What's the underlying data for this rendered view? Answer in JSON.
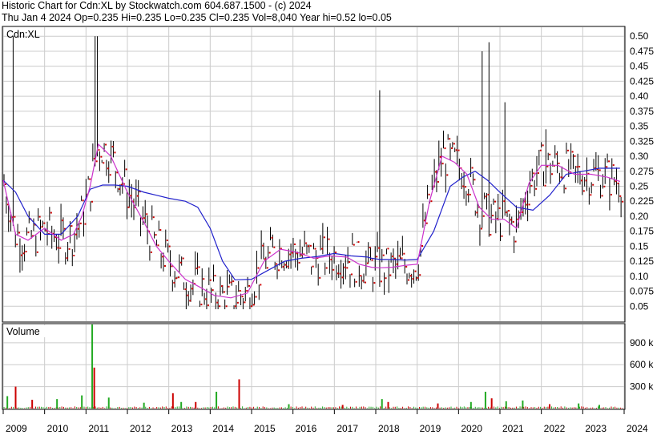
{
  "header": {
    "line1": "Historic Chart for Cdn:XL by Stockwatch.com 604.687.1500 - (c) 2024",
    "line2": "Thu Jan  4 2024  Op=0.235  Hi=0.235  Lo=0.235  Cl=0.235  Vol=8,040  Year hi=0.52  lo=0.05"
  },
  "price_panel": {
    "label": "Cdn:XL"
  },
  "volume_panel": {
    "label": "Volume"
  },
  "colors": {
    "ma_short": "#cc33cc",
    "ma_long": "#2222cc",
    "bar": "#000000",
    "close_dot": "#cc0000",
    "volume_up": "#22aa22",
    "volume_down": "#cc0000",
    "grid": "#cccccc"
  },
  "chart_data": [
    {
      "type": "line",
      "title": "Cdn:XL",
      "x_labels": [
        "2009",
        "2010",
        "2011",
        "2012",
        "2013",
        "2014",
        "2015",
        "2016",
        "2017",
        "2018",
        "2019",
        "2020",
        "2021",
        "2022",
        "2023",
        "2024"
      ],
      "y_ticks": [
        0.05,
        0.075,
        0.1,
        0.125,
        0.15,
        0.175,
        0.2,
        0.225,
        0.25,
        0.275,
        0.3,
        0.325,
        0.35,
        0.375,
        0.4,
        0.425,
        0.45,
        0.475,
        0.5
      ],
      "y_tick_labels": [
        "0.05",
        "0.075",
        "0.10",
        "0.125",
        "0.15",
        "0.175",
        "0.20",
        "0.225",
        "0.25",
        "0.275",
        "0.30",
        "0.325",
        "0.35",
        "0.375",
        "0.40",
        "0.425",
        "0.45",
        "0.475",
        "0.50"
      ],
      "ylim": [
        0.025,
        0.515
      ],
      "grid": true,
      "series": [
        {
          "role": "ma_long",
          "x": [
            2009.0,
            2009.3,
            2009.6,
            2010.0,
            2010.4,
            2010.8,
            2011.1,
            2011.4,
            2011.7,
            2012.0,
            2012.4,
            2012.7,
            2013.0,
            2013.4,
            2013.7,
            2014.0,
            2014.3,
            2014.6,
            2015.0,
            2015.4,
            2015.8,
            2016.2,
            2016.6,
            2017.0,
            2017.4,
            2017.8,
            2017.9,
            2018.1,
            2018.4,
            2018.7,
            2019.0,
            2019.4,
            2019.8,
            2020.1,
            2020.4,
            2020.7,
            2021.0,
            2021.4,
            2021.8,
            2022.2,
            2022.6,
            2023.0,
            2023.4,
            2023.9
          ],
          "y": [
            0.26,
            0.24,
            0.2,
            0.17,
            0.17,
            0.2,
            0.245,
            0.252,
            0.252,
            0.25,
            0.24,
            0.235,
            0.23,
            0.225,
            0.215,
            0.18,
            0.125,
            0.094,
            0.095,
            0.11,
            0.125,
            0.13,
            0.133,
            0.138,
            0.134,
            0.132,
            0.13,
            0.128,
            0.128,
            0.127,
            0.128,
            0.175,
            0.25,
            0.265,
            0.275,
            0.26,
            0.24,
            0.215,
            0.21,
            0.235,
            0.27,
            0.275,
            0.28,
            0.28
          ]
        },
        {
          "role": "ma_short",
          "x": [
            2009.0,
            2009.3,
            2009.6,
            2010.0,
            2010.4,
            2010.7,
            2010.9,
            2011.1,
            2011.3,
            2011.6,
            2012.0,
            2012.4,
            2012.7,
            2013.0,
            2013.4,
            2013.8,
            2014.1,
            2014.5,
            2014.9,
            2015.3,
            2015.7,
            2016.1,
            2016.5,
            2016.9,
            2017.3,
            2017.6,
            2017.9,
            2018.1,
            2018.4,
            2018.7,
            2019.0,
            2019.3,
            2019.6,
            2019.9,
            2020.2,
            2020.5,
            2020.8,
            2021.1,
            2021.4,
            2021.7,
            2022.0,
            2022.4,
            2022.8,
            2023.2,
            2023.6,
            2023.9
          ],
          "y": [
            0.26,
            0.17,
            0.16,
            0.18,
            0.16,
            0.17,
            0.2,
            0.25,
            0.32,
            0.3,
            0.24,
            0.19,
            0.15,
            0.125,
            0.095,
            0.08,
            0.068,
            0.064,
            0.072,
            0.125,
            0.145,
            0.14,
            0.13,
            0.134,
            0.132,
            0.12,
            0.115,
            0.114,
            0.115,
            0.118,
            0.12,
            0.225,
            0.3,
            0.29,
            0.27,
            0.215,
            0.195,
            0.195,
            0.18,
            0.255,
            0.285,
            0.285,
            0.27,
            0.27,
            0.265,
            0.258
          ]
        }
      ]
    },
    {
      "type": "bar",
      "title": "Volume",
      "y_ticks": [
        300000,
        600000,
        900000
      ],
      "y_tick_labels": [
        "300 k",
        "600 k",
        "900 k"
      ],
      "ylim": [
        0,
        1150000
      ],
      "x_labels": [
        "2009",
        "2010",
        "2011",
        "2012",
        "2013",
        "2014",
        "2015",
        "2016",
        "2017",
        "2018",
        "2019",
        "2020",
        "2021",
        "2022",
        "2023",
        "2024"
      ],
      "x_start": 2009,
      "x_end": 2024,
      "spikes": [
        {
          "x": 2009.1,
          "v": 170000,
          "up": true
        },
        {
          "x": 2009.3,
          "v": 300000,
          "up": false
        },
        {
          "x": 2009.7,
          "v": 120000,
          "up": false
        },
        {
          "x": 2010.3,
          "v": 130000,
          "up": true
        },
        {
          "x": 2010.9,
          "v": 180000,
          "up": true
        },
        {
          "x": 2011.15,
          "v": 1150000,
          "up": true
        },
        {
          "x": 2011.2,
          "v": 560000,
          "up": false
        },
        {
          "x": 2011.55,
          "v": 150000,
          "up": true
        },
        {
          "x": 2012.4,
          "v": 80000,
          "up": true
        },
        {
          "x": 2013.1,
          "v": 210000,
          "up": false
        },
        {
          "x": 2013.3,
          "v": 90000,
          "up": true
        },
        {
          "x": 2013.65,
          "v": 90000,
          "up": false
        },
        {
          "x": 2014.15,
          "v": 230000,
          "up": true
        },
        {
          "x": 2014.7,
          "v": 400000,
          "up": false
        },
        {
          "x": 2015.9,
          "v": 60000,
          "up": true
        },
        {
          "x": 2017.2,
          "v": 50000,
          "up": false
        },
        {
          "x": 2018.15,
          "v": 130000,
          "up": true
        },
        {
          "x": 2018.3,
          "v": 90000,
          "up": false
        },
        {
          "x": 2019.5,
          "v": 70000,
          "up": false
        },
        {
          "x": 2020.3,
          "v": 90000,
          "up": true
        },
        {
          "x": 2020.65,
          "v": 230000,
          "up": true
        },
        {
          "x": 2020.8,
          "v": 140000,
          "up": false
        },
        {
          "x": 2021.15,
          "v": 100000,
          "up": true
        },
        {
          "x": 2021.55,
          "v": 110000,
          "up": true
        },
        {
          "x": 2022.2,
          "v": 60000,
          "up": false
        },
        {
          "x": 2022.9,
          "v": 70000,
          "up": true
        },
        {
          "x": 2023.4,
          "v": 50000,
          "up": true
        }
      ]
    }
  ]
}
